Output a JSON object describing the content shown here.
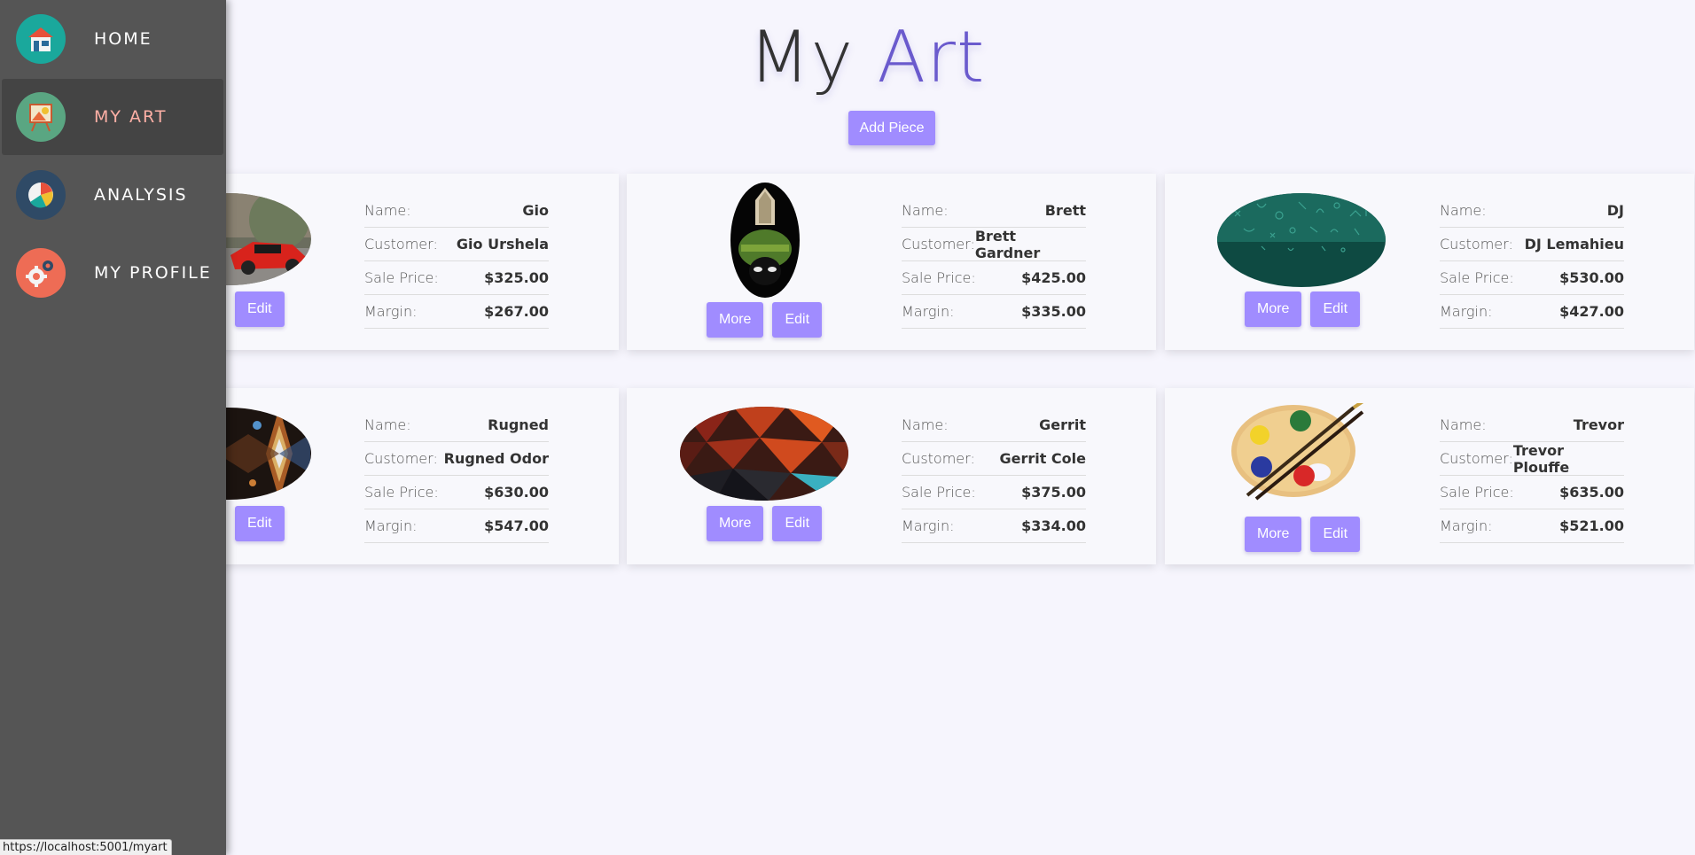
{
  "sidebar": {
    "items": [
      {
        "label": "HOME",
        "icon": "home-icon",
        "color": "#1aa89c"
      },
      {
        "label": "MY ART",
        "icon": "easel-icon",
        "color": "#5aa682",
        "active": true
      },
      {
        "label": "ANALYSIS",
        "icon": "pie-chart-icon",
        "color": "#2f4a66"
      },
      {
        "label": "MY PROFILE",
        "icon": "gear-icon",
        "color": "#ee6c55"
      }
    ]
  },
  "header": {
    "title_part1": "My",
    "title_part2": "Art",
    "add_label": "Add Piece"
  },
  "labels": {
    "name": "Name:",
    "customer": "Customer:",
    "sale_price": "Sale Price:",
    "margin": "Margin:",
    "more": "More",
    "edit": "Edit"
  },
  "cards": [
    {
      "name": "Gio",
      "customer": "Gio Urshela",
      "sale_price": "$325.00",
      "margin": "$267.00",
      "image": "red-sports-car"
    },
    {
      "name": "Brett",
      "customer": "Brett Gardner",
      "sale_price": "$425.00",
      "margin": "$335.00",
      "image": "martian-helmet"
    },
    {
      "name": "DJ",
      "customer": "DJ Lemahieu",
      "sale_price": "$530.00",
      "margin": "$427.00",
      "image": "green-symbols"
    },
    {
      "name": "Rugned",
      "customer": "Rugned Odor",
      "sale_price": "$630.00",
      "margin": "$547.00",
      "image": "kaleidoscope-lights"
    },
    {
      "name": "Gerrit",
      "customer": "Gerrit Cole",
      "sale_price": "$375.00",
      "margin": "$334.00",
      "image": "red-polygon"
    },
    {
      "name": "Trevor",
      "customer": "Trevor Plouffe",
      "sale_price": "$635.00",
      "margin": "$521.00",
      "image": "paint-palette"
    }
  ],
  "status_url": "https://localhost:5001/myart"
}
